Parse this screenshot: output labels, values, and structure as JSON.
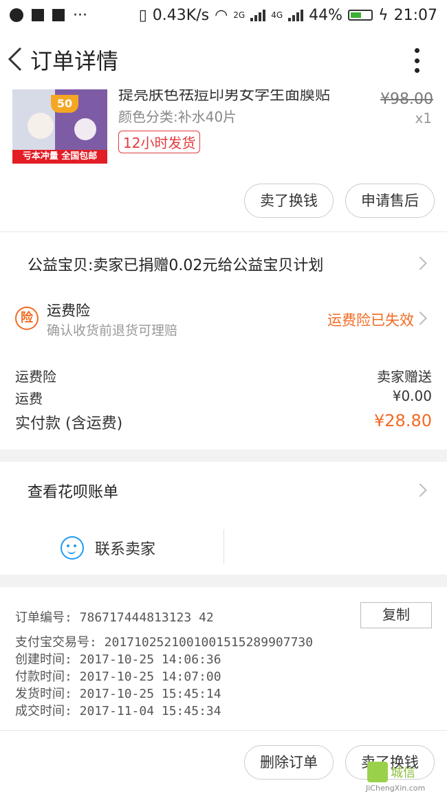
{
  "status_bar": {
    "net_speed": "0.43K/s",
    "network_2g": "2G",
    "network_4g": "4G",
    "battery": "44%",
    "time": "21:07"
  },
  "nav": {
    "title": "订单详情"
  },
  "product": {
    "name": "提亮肤色祛痘印男女学生面膜贴",
    "badge": "50",
    "image_label": "亏本冲量 全国包邮",
    "spec": "颜色分类:补水40片",
    "shipping_tag": "12小时发货",
    "original_price": "¥98.00",
    "quantity": "x1",
    "btn_sell": "卖了换钱",
    "btn_after_sale": "申请售后"
  },
  "charity": {
    "text": "公益宝贝:卖家已捐赠0.02元给公益宝贝计划"
  },
  "insurance": {
    "icon_char": "险",
    "title": "运费险",
    "subtitle": "确认收货前退货可理赔",
    "status": "运费险已失效"
  },
  "fees": {
    "ins_label": "运费险",
    "ins_value": "卖家赠送",
    "ship_label": "运费",
    "ship_value": "¥0.00",
    "total_label": "实付款 (含运费)",
    "total_value": "¥28.80"
  },
  "huabei": {
    "text": "查看花呗账单",
    "contact_label": "联系卖家"
  },
  "order_info": {
    "order_no": "订单编号:  786717444813123 42",
    "copy_label": "复制",
    "alipay_no": "支付宝交易号:  2017102521001001515289907730",
    "created": "创建时间:  2017-10-25 14:06:36",
    "paid": "付款时间:  2017-10-25 14:07:00",
    "shipped": "发货时间:  2017-10-25 15:45:14",
    "completed": "成交时间:  2017-11-04 15:45:34"
  },
  "footer": {
    "btn_delete": "删除订单",
    "btn_sell": "卖了换钱"
  },
  "watermark": {
    "text": "城信",
    "url": "JiChengXin.com"
  },
  "colors": {
    "accent": "#f36a21",
    "red_tag": "#e4393c",
    "contact_blue": "#1e9bf0"
  }
}
